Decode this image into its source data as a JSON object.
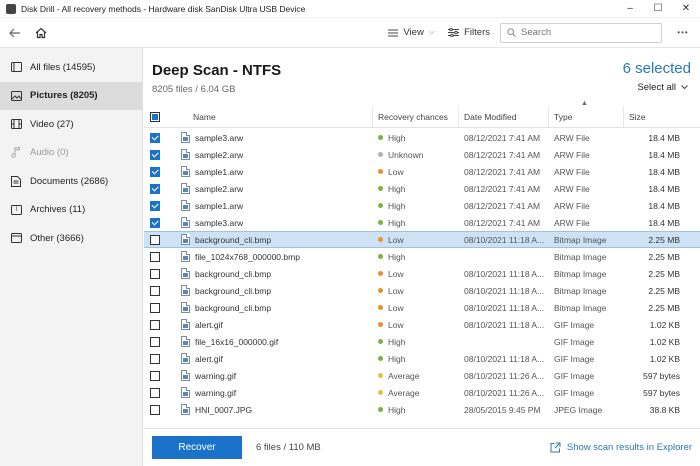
{
  "window": {
    "title": "Disk Drill - All recovery methods - Hardware disk SanDisk Ultra USB Device",
    "minimize": "–",
    "maximize": "☐",
    "close": "✕"
  },
  "toolbar": {
    "view_label": "View",
    "filters_label": "Filters",
    "search_placeholder": "Search",
    "more": "•••"
  },
  "sidebar": {
    "items": [
      {
        "label": "All files (14595)",
        "icon": "file-icon"
      },
      {
        "label": "Pictures (8205)",
        "icon": "picture-icon"
      },
      {
        "label": "Video (27)",
        "icon": "video-icon"
      },
      {
        "label": "Audio (0)",
        "icon": "audio-icon"
      },
      {
        "label": "Documents (2686)",
        "icon": "document-icon"
      },
      {
        "label": "Archives (11)",
        "icon": "archive-icon"
      },
      {
        "label": "Other (3666)",
        "icon": "other-icon"
      }
    ]
  },
  "main": {
    "title": "Deep Scan - NTFS",
    "subtitle": "8205 files / 6.04 GB",
    "selected": "6 selected",
    "select_all": "Select all"
  },
  "table": {
    "headers": {
      "name": "Name",
      "recovery": "Recovery chances",
      "date": "Date Modified",
      "type": "Type",
      "size": "Size"
    },
    "rows": [
      {
        "checked": true,
        "name": "sample3.arw",
        "recovery": "High",
        "rec_color": "#7cb342",
        "date": "08/12/2021 7:41 AM",
        "type": "ARW File",
        "size": "18.4 MB"
      },
      {
        "checked": true,
        "name": "sample2.arw",
        "recovery": "Unknown",
        "rec_color": "#b0b0b0",
        "date": "08/12/2021 7:41 AM",
        "type": "ARW File",
        "size": "18.4 MB"
      },
      {
        "checked": true,
        "name": "sample1.arw",
        "recovery": "Low",
        "rec_color": "#e8912d",
        "date": "08/12/2021 7:41 AM",
        "type": "ARW File",
        "size": "18.4 MB"
      },
      {
        "checked": true,
        "name": "sample2.arw",
        "recovery": "High",
        "rec_color": "#7cb342",
        "date": "08/12/2021 7:41 AM",
        "type": "ARW File",
        "size": "18.4 MB"
      },
      {
        "checked": true,
        "name": "sample1.arw",
        "recovery": "High",
        "rec_color": "#7cb342",
        "date": "08/12/2021 7:41 AM",
        "type": "ARW File",
        "size": "18.4 MB"
      },
      {
        "checked": true,
        "name": "sample3.arw",
        "recovery": "High",
        "rec_color": "#7cb342",
        "date": "08/12/2021 7:41 AM",
        "type": "ARW File",
        "size": "18.4 MB"
      },
      {
        "checked": false,
        "name": "background_cli.bmp",
        "recovery": "Low",
        "rec_color": "#e8912d",
        "date": "08/10/2021 11:18 A...",
        "type": "Bitmap Image",
        "size": "2.25 MB",
        "highlight": true
      },
      {
        "checked": false,
        "name": "file_1024x768_000000.bmp",
        "recovery": "High",
        "rec_color": "#7cb342",
        "date": "",
        "type": "Bitmap Image",
        "size": "2.25 MB"
      },
      {
        "checked": false,
        "name": "background_cli.bmp",
        "recovery": "Low",
        "rec_color": "#e8912d",
        "date": "08/10/2021 11:18 A...",
        "type": "Bitmap Image",
        "size": "2.25 MB"
      },
      {
        "checked": false,
        "name": "background_cli.bmp",
        "recovery": "Low",
        "rec_color": "#e8912d",
        "date": "08/10/2021 11:18 A...",
        "type": "Bitmap Image",
        "size": "2.25 MB"
      },
      {
        "checked": false,
        "name": "background_cli.bmp",
        "recovery": "Low",
        "rec_color": "#e8912d",
        "date": "08/10/2021 11:18 A...",
        "type": "Bitmap Image",
        "size": "2.25 MB"
      },
      {
        "checked": false,
        "name": "alert.gif",
        "recovery": "Low",
        "rec_color": "#e8912d",
        "date": "08/10/2021 11:18 A...",
        "type": "GIF Image",
        "size": "1.02 KB"
      },
      {
        "checked": false,
        "name": "file_16x16_000000.gif",
        "recovery": "High",
        "rec_color": "#7cb342",
        "date": "",
        "type": "GIF Image",
        "size": "1.02 KB"
      },
      {
        "checked": false,
        "name": "alert.gif",
        "recovery": "High",
        "rec_color": "#7cb342",
        "date": "08/10/2021 11:18 A...",
        "type": "GIF Image",
        "size": "1.02 KB"
      },
      {
        "checked": false,
        "name": "warning.gif",
        "recovery": "Average",
        "rec_color": "#e0c23a",
        "date": "08/10/2021 11:26 A...",
        "type": "GIF Image",
        "size": "597 bytes"
      },
      {
        "checked": false,
        "name": "warning.gif",
        "recovery": "Average",
        "rec_color": "#e0c23a",
        "date": "08/10/2021 11:26 A...",
        "type": "GIF Image",
        "size": "597 bytes"
      },
      {
        "checked": false,
        "name": "HNI_0007.JPG",
        "recovery": "High",
        "rec_color": "#7cb342",
        "date": "28/05/2015 9:45 PM",
        "type": "JPEG Image",
        "size": "38.8 KB"
      }
    ]
  },
  "footer": {
    "recover_label": "Recover",
    "files_info": "6 files / 110 MB",
    "explorer_link": "Show scan results in Explorer"
  }
}
